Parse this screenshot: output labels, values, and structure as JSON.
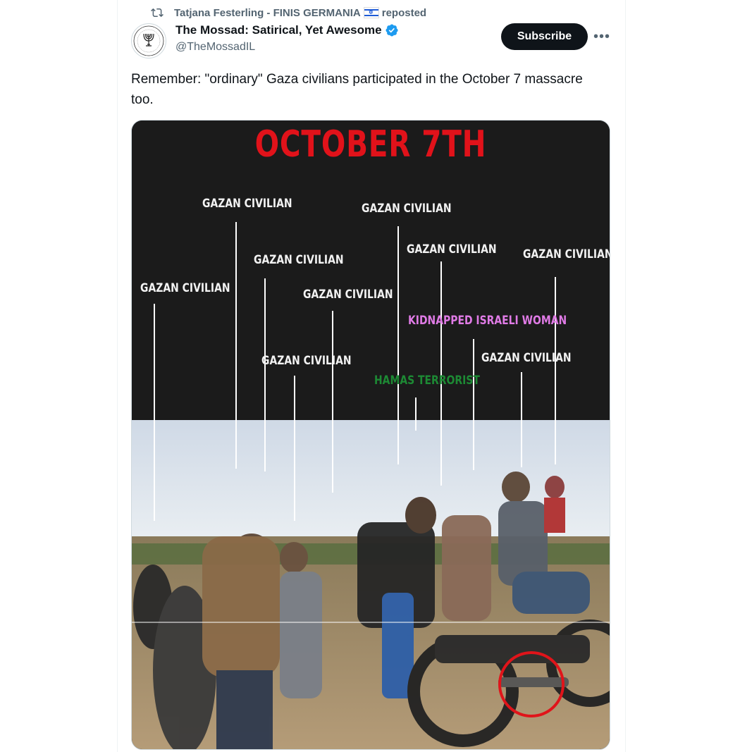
{
  "repost": {
    "icon": "repost-icon",
    "user": "Tatjana Festerling - FINIS GERMANIA",
    "flag": "israel-flag-icon",
    "suffix": "reposted"
  },
  "author": {
    "name": "The Mossad: Satirical, Yet Awesome",
    "handle": "@TheMossadIL",
    "verified": true
  },
  "actions": {
    "subscribe_label": "Subscribe",
    "more_label": "•••"
  },
  "tweet": {
    "text": "Remember: \"ordinary\" Gaza civilians participated in the October 7 massacre too."
  },
  "media": {
    "title": "OCTOBER 7TH",
    "labels": [
      "GAZAN CIVILIAN",
      "GAZAN CIVILIAN",
      "GAZAN CIVILIAN",
      "GAZAN CIVILIAN",
      "GAZAN CIVILIAN",
      "GAZAN CIVILIAN",
      "GAZAN CIVILIAN",
      "GAZAN CIVILIAN",
      "GAZAN CIVILIAN",
      "KIDNAPPED ISRAELI WOMAN",
      "HAMAS TERRORIST"
    ],
    "colors": {
      "title": "#e1121a",
      "civilian": "#f2f2f2",
      "woman": "#e07be6",
      "terrorist": "#1d8a34",
      "circle": "#e0141a"
    }
  }
}
